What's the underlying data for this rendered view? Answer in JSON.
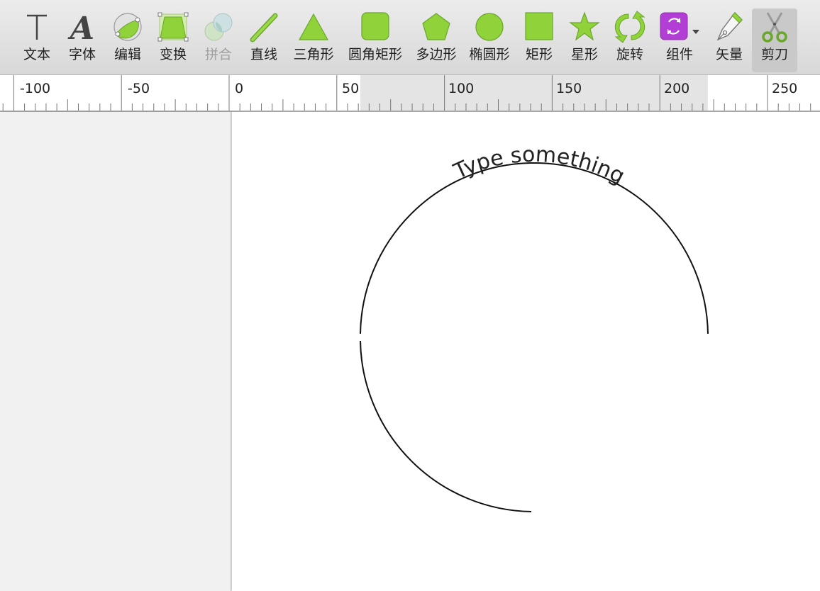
{
  "toolbar": {
    "items": [
      {
        "label": "文本",
        "icon": "text-tool-icon"
      },
      {
        "label": "字体",
        "icon": "font-icon"
      },
      {
        "label": "编辑",
        "icon": "edit-path-icon"
      },
      {
        "label": "变换",
        "icon": "transform-icon"
      },
      {
        "label": "拼合",
        "icon": "combine-icon",
        "disabled": true
      },
      {
        "label": "直线",
        "icon": "line-icon"
      },
      {
        "label": "三角形",
        "icon": "triangle-icon"
      },
      {
        "label": "圆角矩形",
        "icon": "rounded-rectangle-icon"
      },
      {
        "label": "多边形",
        "icon": "polygon-icon"
      },
      {
        "label": "椭圆形",
        "icon": "ellipse-icon"
      },
      {
        "label": "矩形",
        "icon": "rectangle-icon"
      },
      {
        "label": "星形",
        "icon": "star-icon"
      },
      {
        "label": "旋转",
        "icon": "rotate-icon"
      },
      {
        "label": "组件",
        "icon": "component-icon"
      },
      {
        "label": "矢量",
        "icon": "vector-pen-icon"
      },
      {
        "label": "剪刀",
        "icon": "scissors-icon",
        "active": true
      }
    ]
  },
  "ruler": {
    "labels": [
      "-100",
      "-50",
      "0",
      "50",
      "100",
      "150",
      "200",
      "250"
    ]
  },
  "canvas": {
    "path_text": "Type something"
  },
  "colors": {
    "accent_green": "#8fd23a",
    "component_purple": "#b33ed6"
  }
}
